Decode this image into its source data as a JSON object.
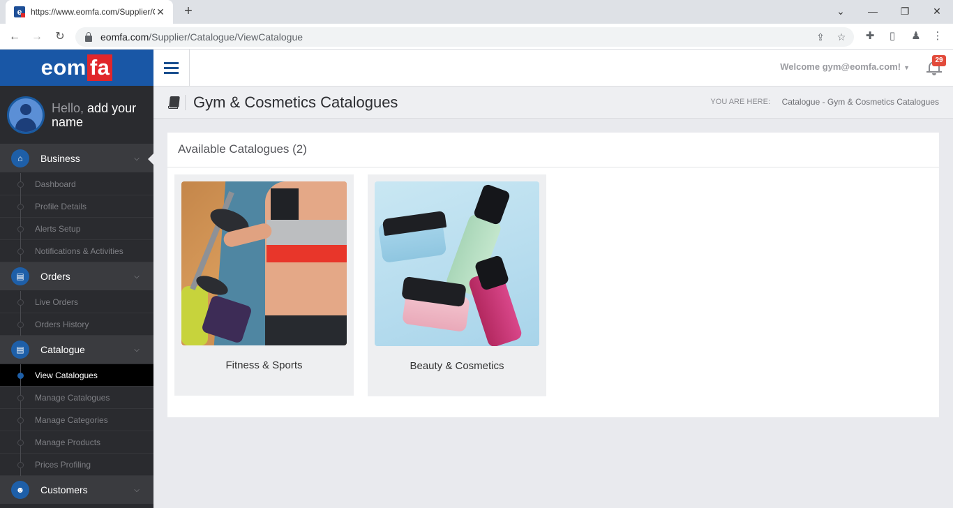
{
  "browser": {
    "tab_title": "https://www.eomfa.com/Supplier/Catalogue/ViewCatalogue",
    "favicon_letter": "e",
    "url_host": "eomfa.com",
    "url_path": "/Supplier/Catalogue/ViewCatalogue"
  },
  "brand": {
    "logo_main": "eom",
    "logo_accent": "fa",
    "primary_color": "#1957a6",
    "accent_color": "#e0262b"
  },
  "profile": {
    "hello": "Hello,",
    "prompt": "add your name"
  },
  "sidebar": {
    "business": {
      "label": "Business",
      "icon": "home-icon",
      "items": [
        "Dashboard",
        "Profile Details",
        "Alerts Setup",
        "Notifications & Activities"
      ]
    },
    "orders": {
      "label": "Orders",
      "icon": "book-icon",
      "items": [
        "Live Orders",
        "Orders History"
      ]
    },
    "catalogue": {
      "label": "Catalogue",
      "icon": "book-icon",
      "items": [
        "View Catalogues",
        "Manage Catalogues",
        "Manage Categories",
        "Manage Products",
        "Prices Profiling"
      ]
    },
    "customers": {
      "label": "Customers",
      "icon": "users-icon"
    }
  },
  "topbar": {
    "welcome": "Welcome gym@eomfa.com!",
    "notification_count": "29"
  },
  "page": {
    "title": "Gym & Cosmetics Catalogues",
    "breadcrumb_label": "YOU ARE HERE:",
    "breadcrumb": "Catalogue - Gym & Cosmetics Catalogues"
  },
  "catalogues": {
    "heading": "Available Catalogues (2)",
    "items": [
      {
        "name": "Fitness & Sports"
      },
      {
        "name": "Beauty & Cosmetics"
      }
    ]
  }
}
